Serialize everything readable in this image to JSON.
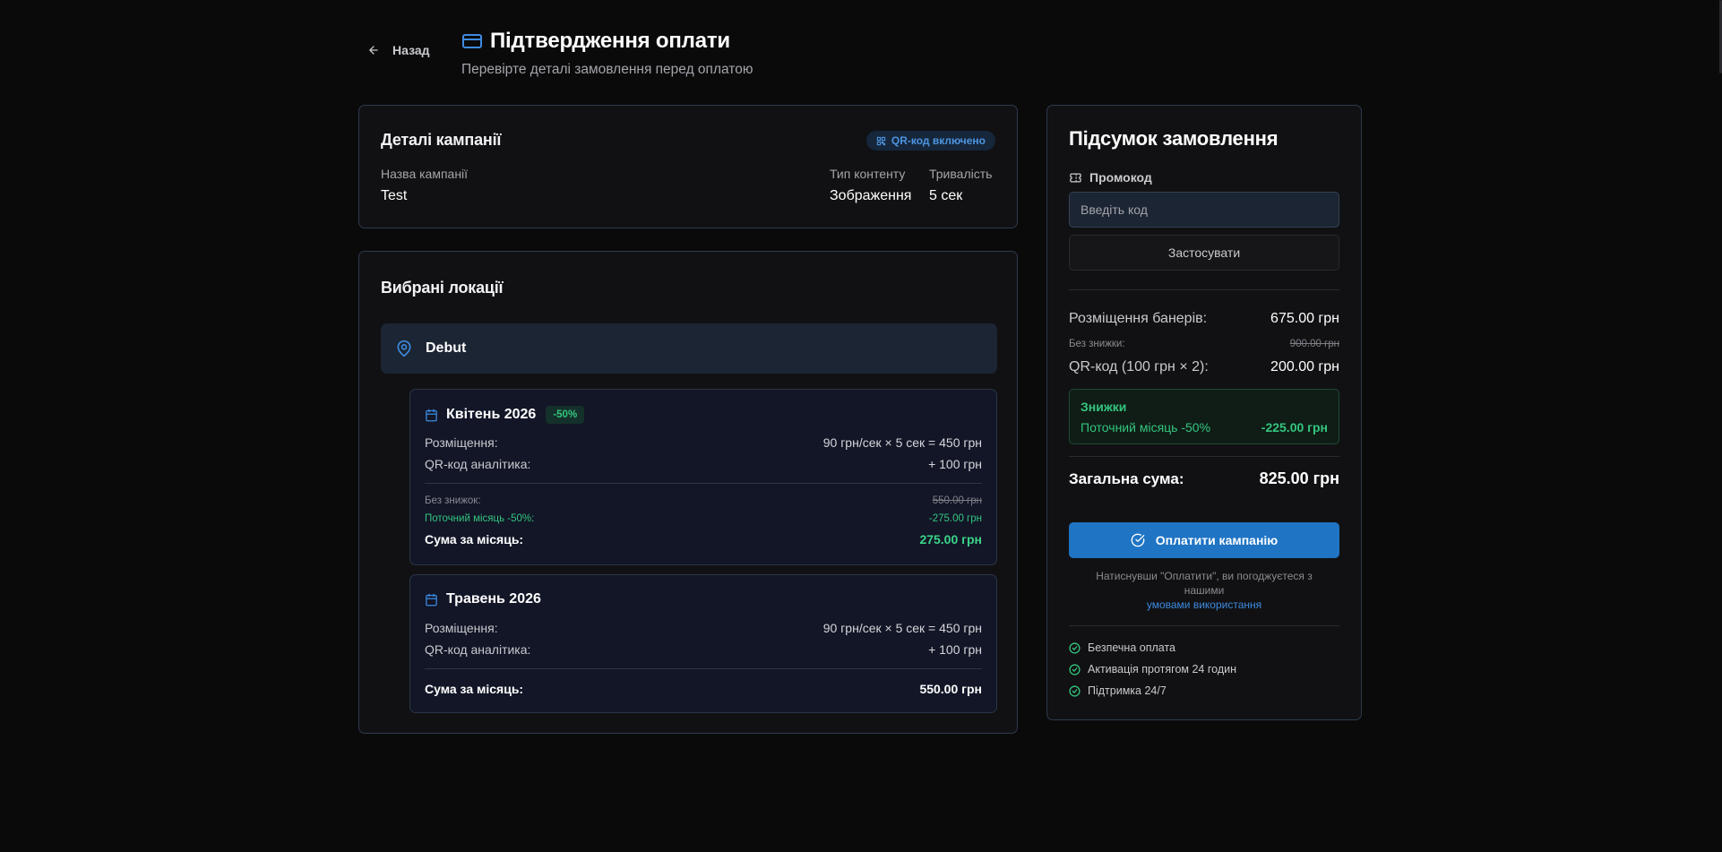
{
  "header": {
    "back_label": "Назад",
    "title": "Підтвердження оплати",
    "subtitle": "Перевірте деталі замовлення перед оплатою"
  },
  "campaign": {
    "title": "Деталі кампанії",
    "qr_badge": "QR-код включено",
    "name_label": "Назва кампанії",
    "name_value": "Test",
    "content_type_label": "Тип контенту",
    "content_type_value": "Зображення",
    "duration_label": "Тривалість",
    "duration_value": "5 сек"
  },
  "locations": {
    "title": "Вибрані локації",
    "items": [
      {
        "name": "Debut",
        "months": [
          {
            "title": "Квітень 2026",
            "discount_badge": "-50%",
            "placement_label": "Розміщення:",
            "placement_value": "90 грн/сек × 5 сек = 450 грн",
            "qr_label": "QR-код аналітика:",
            "qr_value": "+ 100 грн",
            "no_discount_label": "Без знижок:",
            "no_discount_value": "550.00 грн",
            "discount_label": "Поточний місяць -50%:",
            "discount_value": "-275.00 грн",
            "sum_label": "Сума за місяць:",
            "sum_value": "275.00 грн"
          },
          {
            "title": "Травень 2026",
            "placement_label": "Розміщення:",
            "placement_value": "90 грн/сек × 5 сек = 450 грн",
            "qr_label": "QR-код аналітика:",
            "qr_value": "+ 100 грн",
            "sum_label": "Сума за місяць:",
            "sum_value": "550.00 грн"
          }
        ]
      }
    ]
  },
  "summary": {
    "title": "Підсумок замовлення",
    "promo_label": "Промокод",
    "promo_placeholder": "Введіть код",
    "apply_label": "Застосувати",
    "banners_label": "Розміщення банерів:",
    "banners_value": "675.00 грн",
    "no_discount_label": "Без знижки:",
    "no_discount_value": "900.00 грн",
    "qr_label": "QR-код (100 грн × 2):",
    "qr_value": "200.00 грн",
    "discounts_title": "Знижки",
    "discount_label": "Поточний місяць -50%",
    "discount_value": "-225.00 грн",
    "total_label": "Загальна сума:",
    "total_value": "825.00 грн",
    "pay_label": "Оплатити кампанію",
    "terms_text": "Натиснувши \"Оплатити\", ви погоджуєтеся з нашими",
    "terms_link": "умовами використання",
    "features": [
      "Безпечна оплата",
      "Активація протягом 24 годин",
      "Підтримка 24/7"
    ]
  },
  "colors": {
    "accent": "#1f74c4",
    "link": "#3d8be0",
    "success": "#34c57e",
    "background": "#0a0a0b",
    "card": "#111113"
  },
  "icons": {
    "back": "arrow-left-icon",
    "title": "credit-card-icon",
    "qr": "qr-code-icon",
    "location": "map-pin-icon",
    "month": "calendar-icon",
    "promo": "ticket-icon",
    "pay": "check-circle-icon",
    "feature": "check-circle-icon"
  }
}
